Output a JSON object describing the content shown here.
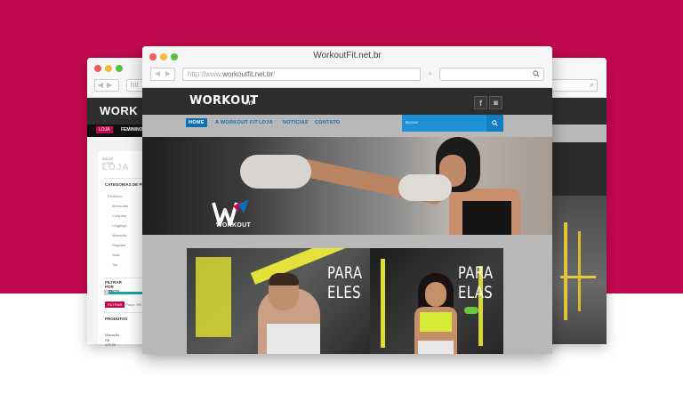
{
  "colors": {
    "brand_background": "#c2094f",
    "site_header": "#2d2d2d",
    "menu_bar": "#b8b8b8",
    "menu_accent": "#0a6fb7",
    "site_search": "#1e90d6"
  },
  "main_window": {
    "title": "WorkoutFit.net.br",
    "url_prefix": "http://www.",
    "url_domain": "workoutfit.net.br",
    "url_suffix": "/",
    "new_tab": "+",
    "back_icon": "back-arrow-icon",
    "forward_icon": "forward-arrow-icon",
    "search_icon": "search-icon"
  },
  "site": {
    "logo": "WORKOUT",
    "logo_suffix": "FIT",
    "social": [
      {
        "icon": "facebook-icon",
        "glyph": "f"
      },
      {
        "icon": "instagram-icon",
        "glyph": "◙"
      }
    ],
    "menu": [
      {
        "label": "HOME",
        "active": true
      },
      {
        "label": "A WORKOUT FIT",
        "active": false
      },
      {
        "label": "LOJA",
        "active": false
      },
      {
        "label": "NOTÍCIAS",
        "active": false
      },
      {
        "label": "CONTATO",
        "active": false
      }
    ],
    "search_placeholder": "Buscar",
    "hero_logo_text": "WORKOUT",
    "banner_left_text": [
      "PARA",
      "ELES"
    ],
    "banner_right_text": [
      "PARA",
      "ELAS"
    ]
  },
  "left_window": {
    "url": "htt",
    "logo": "WORK",
    "menu_loja": "LOJA",
    "menu_feminino": "FEMININO",
    "breadcrumb": "INÍCIO / LOJA",
    "page_title": "LOJA",
    "categories_heading": "CATEGORIAS DE PRODU",
    "categories": [
      "Feminino",
      "Bermudas",
      "Conjunto",
      "Leggings",
      "Macacão",
      "Regatas",
      "Saia",
      "Top"
    ],
    "filter_heading": "FILTRAR POR PREÇO",
    "filter_button": "FILTRAR",
    "price_label": "Preço: R$",
    "products_heading": "PRODUTOS",
    "product_name": "Macacão",
    "product_price": "R$ 139,00"
  }
}
